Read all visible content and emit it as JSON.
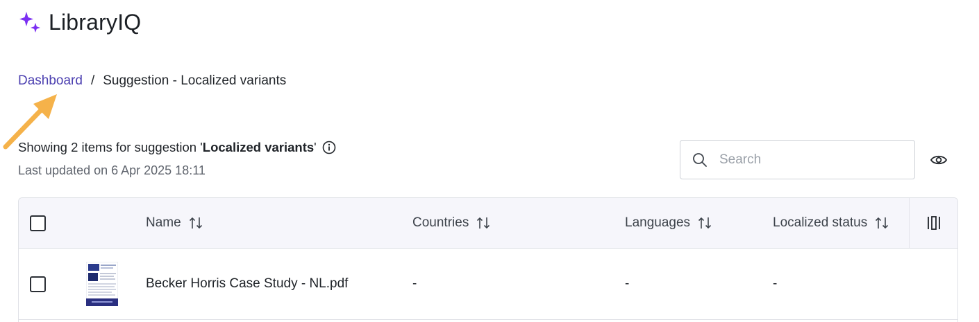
{
  "app": {
    "name": "LibraryIQ",
    "brand_color": "#7b2ff2"
  },
  "breadcrumb": {
    "link": "Dashboard",
    "separator": "/",
    "current": "Suggestion - Localized variants"
  },
  "summary": {
    "prefix": "Showing 2 items for suggestion '",
    "suggestion": "Localized variants",
    "suffix": "'",
    "updated": "Last updated on 6 Apr 2025 18:11"
  },
  "search": {
    "placeholder": "Search",
    "value": ""
  },
  "table": {
    "columns": [
      "Name",
      "Countries",
      "Languages",
      "Localized status"
    ],
    "rows": [
      {
        "name": "Becker Horris Case Study - NL.pdf",
        "countries": "-",
        "languages": "-",
        "localized_status": "-"
      }
    ]
  },
  "icons": {
    "logo": "sparkle-icon",
    "info": "info-icon",
    "search": "search-icon",
    "visibility": "eye-icon",
    "sort": "sort-arrows-icon",
    "columns": "column-settings-icon",
    "annotation": "arrow-annotation-icon"
  },
  "colors": {
    "link": "#4b3fb0",
    "annotation": "#f5b24a",
    "header_bg": "#f6f6fb"
  }
}
